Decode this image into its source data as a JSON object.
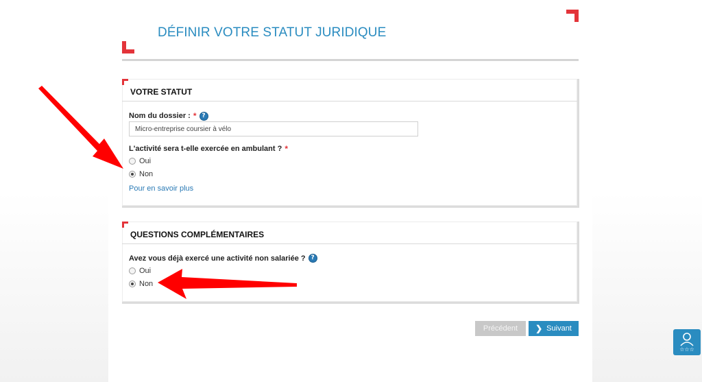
{
  "page": {
    "title": "DÉFINIR VOTRE STATUT JURIDIQUE",
    "accent_color": "#e3343a",
    "title_color": "#2a8cc0"
  },
  "statut": {
    "heading": "VOTRE STATUT",
    "dossier_label": "Nom du dossier :",
    "dossier_value": "Micro-entreprise coursier à vélo",
    "ambulant_question": "L'activité sera t-elle exercée en ambulant ?",
    "options": [
      {
        "label": "Oui",
        "checked": false
      },
      {
        "label": "Non",
        "checked": true
      }
    ],
    "more_link": "Pour en savoir plus"
  },
  "questions": {
    "heading": "QUESTIONS COMPLÉMENTAIRES",
    "question": "Avez vous déjà exercé une activité non salariée ?",
    "options": [
      {
        "label": "Oui",
        "checked": false
      },
      {
        "label": "Non",
        "checked": true
      }
    ]
  },
  "nav": {
    "prev_label": "Précédent",
    "next_label": "Suivant"
  },
  "icons": {
    "help": "help-icon",
    "next": "chevron-right-icon",
    "chat": "support-agent-icon"
  },
  "annotation_color": "#ff0000"
}
